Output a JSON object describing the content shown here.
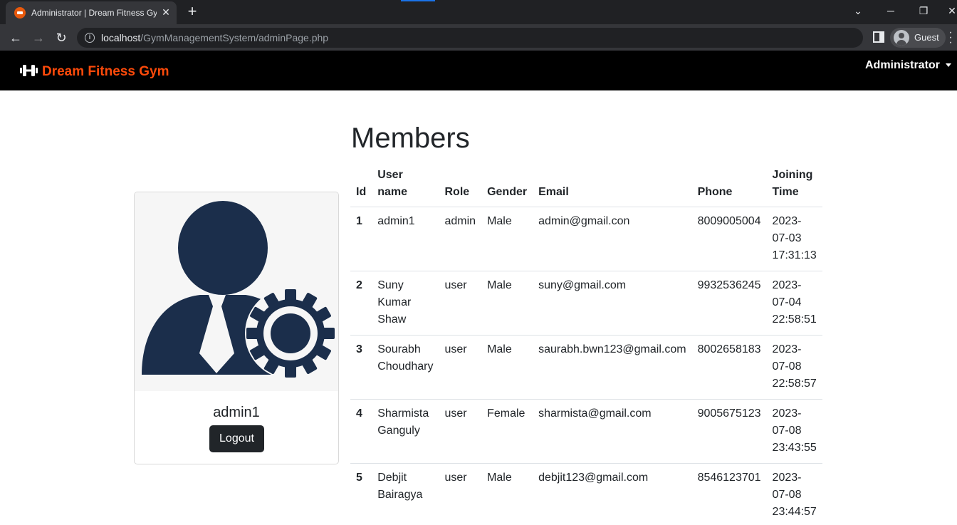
{
  "browser": {
    "tab_title": "Administrator | Dream Fitness Gym",
    "url_host": "localhost",
    "url_path": "/GymManagementSystem/adminPage.php",
    "profile_label": "Guest"
  },
  "navbar": {
    "brand": "Dream Fitness Gym",
    "brand_color": "#fd4a0a",
    "user_menu": "Administrator"
  },
  "profile": {
    "name": "admin1",
    "logout_label": "Logout",
    "image_icon": "admin-user-gear-icon",
    "icon_color": "#1b2e4b"
  },
  "members": {
    "title": "Members",
    "headers": [
      "Id",
      "User name",
      "Role",
      "Gender",
      "Email",
      "Phone",
      "Joining Time"
    ],
    "rows": [
      [
        "1",
        "admin1",
        "admin",
        "Male",
        "admin@gmail.con",
        "8009005004",
        "2023-07-03 17:31:13"
      ],
      [
        "2",
        "Suny Kumar Shaw",
        "user",
        "Male",
        "suny@gmail.com",
        "9932536245",
        "2023-07-04 22:58:51"
      ],
      [
        "3",
        "Sourabh Choudhary",
        "user",
        "Male",
        "saurabh.bwn123@gmail.com",
        "8002658183",
        "2023-07-08 22:58:57"
      ],
      [
        "4",
        "Sharmista Ganguly",
        "user",
        "Female",
        "sharmista@gmail.com",
        "9005675123",
        "2023-07-08 23:43:55"
      ],
      [
        "5",
        "Debjit Bairagya",
        "user",
        "Male",
        "debjit123@gmail.com",
        "8546123701",
        "2023-07-08 23:44:57"
      ]
    ]
  }
}
